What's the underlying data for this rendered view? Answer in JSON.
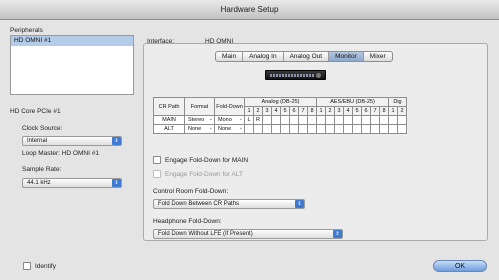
{
  "window": {
    "title": "Hardware Setup"
  },
  "peripherals": {
    "label": "Peripherals",
    "items": [
      "HD OMNI #1"
    ]
  },
  "left": {
    "device_label": "HD Core PCIe #1",
    "clock_source_label": "Clock Source:",
    "clock_source_value": "Internal",
    "loop_master": "Loop Master: HD OMNI #1",
    "sample_rate_label": "Sample Rate:",
    "sample_rate_value": "44.1 kHz"
  },
  "interface": {
    "label": "Interface:",
    "value": "HD OMNI"
  },
  "tabs": [
    {
      "label": "Main",
      "active": false
    },
    {
      "label": "Analog In",
      "active": false
    },
    {
      "label": "Analog Out",
      "active": false
    },
    {
      "label": "Monitor",
      "active": true
    },
    {
      "label": "Mixer",
      "active": false
    }
  ],
  "table": {
    "col_cr_path": "CR Path",
    "col_format": "Format",
    "col_fold_down": "Fold-Down",
    "group_analog": "Analog (DB-25)",
    "group_aes": "AES/EBU (DB-25)",
    "group_dig": "Dig",
    "analog_numbers": [
      "1",
      "2",
      "3",
      "4",
      "5",
      "6",
      "7",
      "8"
    ],
    "aes_numbers": [
      "1",
      "2",
      "3",
      "4",
      "5",
      "6",
      "7",
      "8"
    ],
    "dig_numbers": [
      "1",
      "2"
    ],
    "rows": [
      {
        "path": "MAIN",
        "format": "Stereo",
        "fold": "Mono",
        "a1": "L",
        "a2": "R"
      },
      {
        "path": "ALT",
        "format": "None",
        "fold": "None",
        "a1": "",
        "a2": ""
      }
    ]
  },
  "checks": {
    "engage_main": "Engage Fold-Down for MAIN",
    "engage_alt": "Engage Fold-Down for ALT"
  },
  "control_room": {
    "label": "Control Room Fold-Down:",
    "value": "Fold Down Between CR Paths"
  },
  "headphone": {
    "label": "Headphone Fold-Down:",
    "value": "Fold Down Without LFE (If Present)"
  },
  "identify_label": "Identify",
  "ok_label": "OK",
  "colors": {
    "accent": "#3e79d2",
    "selection": "#b5cce8"
  }
}
